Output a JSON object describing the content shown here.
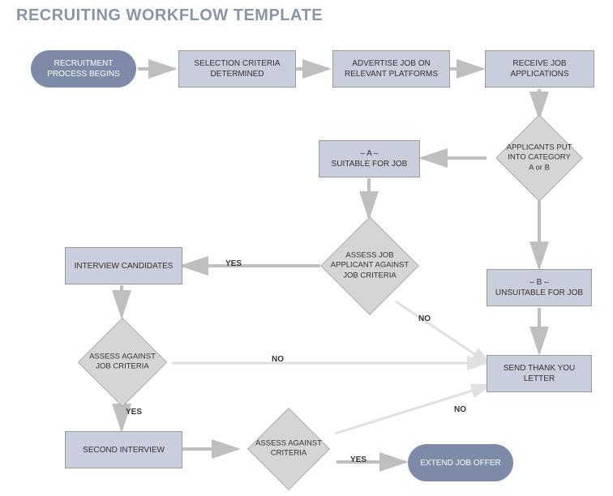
{
  "title": "RECRUITING WORKFLOW TEMPLATE",
  "nodes": {
    "start": "RECRUITMENT PROCESS BEGINS",
    "criteria": "SELECTION CRITERIA DETERMINED",
    "advertise": "ADVERTISE JOB ON RELEVANT PLATFORMS",
    "receive": "RECEIVE JOB APPLICATIONS",
    "suitable": "– A –\nSUITABLE FOR JOB",
    "unsuitable": "– B –\nUNSUITABLE FOR JOB",
    "interview": "INTERVIEW CANDIDATES",
    "second_interview": "SECOND INTERVIEW",
    "thank_you": "SEND THANK YOU LETTER",
    "offer": "EXTEND JOB OFFER"
  },
  "decisions": {
    "categorize": "APPLICANTS PUT INTO CATEGORY\nA or B",
    "assess_a": "ASSESS JOB APPLICANT AGAINST JOB CRITERIA",
    "assess_interview": "ASSESS AGAINST JOB CRITERIA",
    "assess_second": "ASSESS AGAINST CRITERIA"
  },
  "labels": {
    "yes": "YES",
    "no": "NO"
  }
}
